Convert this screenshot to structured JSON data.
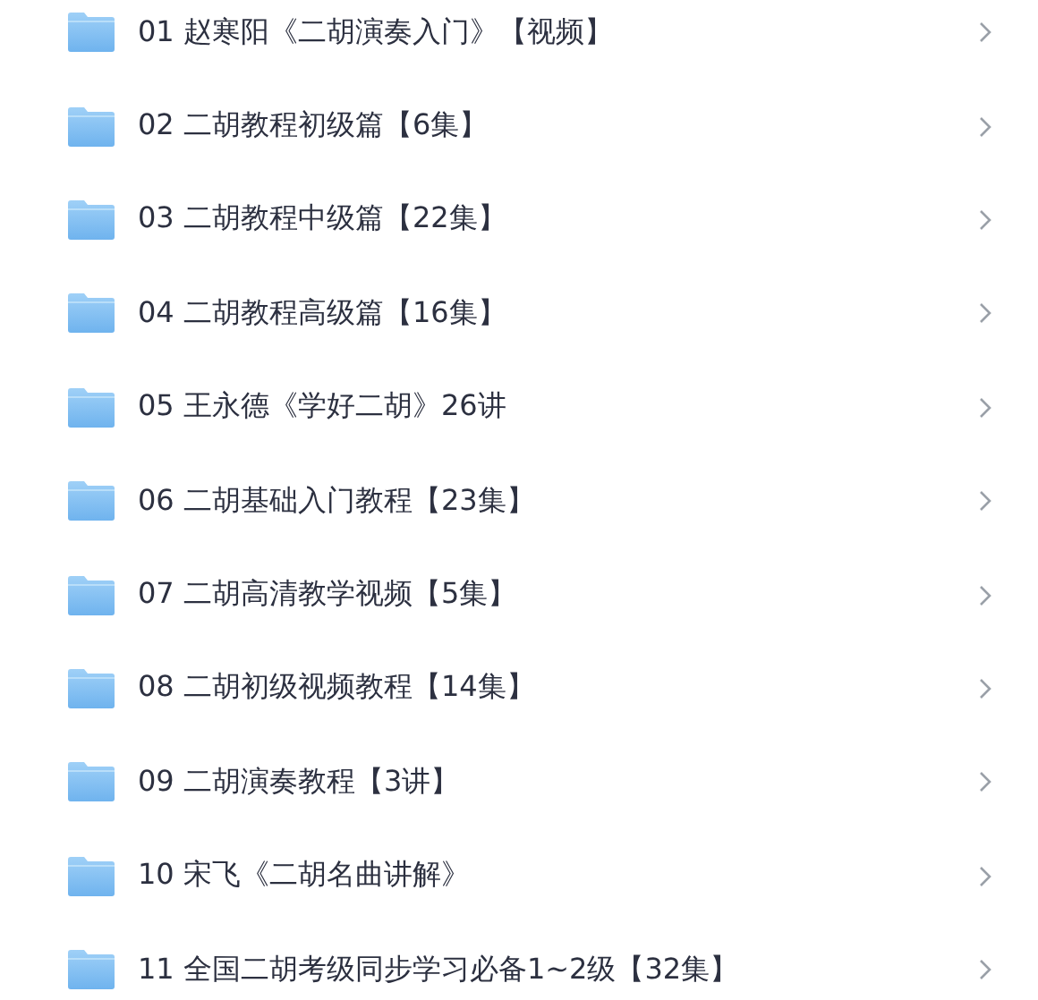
{
  "folders": [
    {
      "name": "01 赵寒阳《二胡演奏入门》【视频】"
    },
    {
      "name": "02 二胡教程初级篇【6集】"
    },
    {
      "name": "03 二胡教程中级篇【22集】"
    },
    {
      "name": "04 二胡教程高级篇【16集】"
    },
    {
      "name": "05 王永德《学好二胡》26讲"
    },
    {
      "name": "06 二胡基础入门教程【23集】"
    },
    {
      "name": "07 二胡高清教学视频【5集】"
    },
    {
      "name": "08 二胡初级视频教程【14集】"
    },
    {
      "name": "09 二胡演奏教程【3讲】"
    },
    {
      "name": "10 宋飞《二胡名曲讲解》"
    },
    {
      "name": "11 全国二胡考级同步学习必备1~2级【32集】"
    }
  ]
}
